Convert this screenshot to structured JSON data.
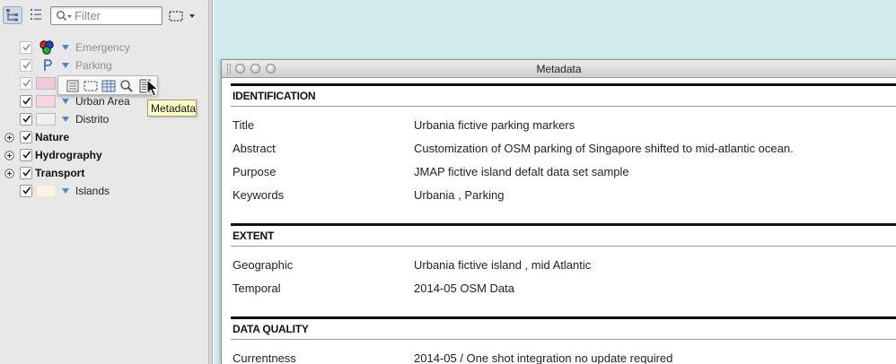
{
  "layer_panel": {
    "filter": {
      "value": "",
      "placeholder": "Filter"
    },
    "layers": [
      {
        "label": "Emergency",
        "type": "layer",
        "checked": true,
        "dimmed": true,
        "symbol": "emergency-symbol-icon"
      },
      {
        "label": "Parking",
        "type": "layer",
        "checked": true,
        "dimmed": true,
        "symbol": "parking-p-icon"
      },
      {
        "label": "",
        "type": "layer",
        "checked": true,
        "dimmed": true,
        "swatch": "#f1c8de"
      },
      {
        "label": "Urban Area",
        "type": "layer",
        "checked": true,
        "dimmed": false,
        "swatch": "#f6d5e3"
      },
      {
        "label": "Distrito",
        "type": "layer",
        "checked": true,
        "dimmed": false,
        "swatch": "#f0f0f0"
      },
      {
        "label": "Nature",
        "type": "group",
        "checked": true
      },
      {
        "label": "Hydrography",
        "type": "group",
        "checked": true
      },
      {
        "label": "Transport",
        "type": "group",
        "checked": true
      },
      {
        "label": "Islands",
        "type": "layer",
        "checked": true,
        "dimmed": false,
        "swatch": "#fdf2e2"
      }
    ],
    "layer_toolbar": {
      "buttons": [
        "attributes-list-icon",
        "selection-rect-icon",
        "table-icon",
        "zoom-magnifier-icon",
        "metadata-icon"
      ]
    },
    "tooltip": "Metadata"
  },
  "metadata_window": {
    "title": "Metadata",
    "sections": [
      {
        "title": "IDENTIFICATION",
        "rows": [
          {
            "key": "Title",
            "value": "Urbania fictive parking markers"
          },
          {
            "key": "Abstract",
            "value": "Customization of OSM parking of Singapore shifted to mid-atlantic ocean."
          },
          {
            "key": "Purpose",
            "value": "JMAP fictive island defalt data set sample"
          },
          {
            "key": "Keywords",
            "value": "Urbania , Parking"
          }
        ]
      },
      {
        "title": "EXTENT",
        "rows": [
          {
            "key": "Geographic",
            "value": "Urbania fictive island , mid Atlantic"
          },
          {
            "key": "Temporal",
            "value": "2014-05 OSM Data"
          }
        ]
      },
      {
        "title": "DATA QUALITY",
        "rows": [
          {
            "key": "Currentness",
            "value": "2014-05 / One shot integration no update required"
          }
        ]
      }
    ]
  },
  "colors": {
    "canvas": "#d1ecec",
    "panel": "#e8e8e8",
    "tooltip": "#ffffc6",
    "accent_triangle": "#4f86c6"
  }
}
